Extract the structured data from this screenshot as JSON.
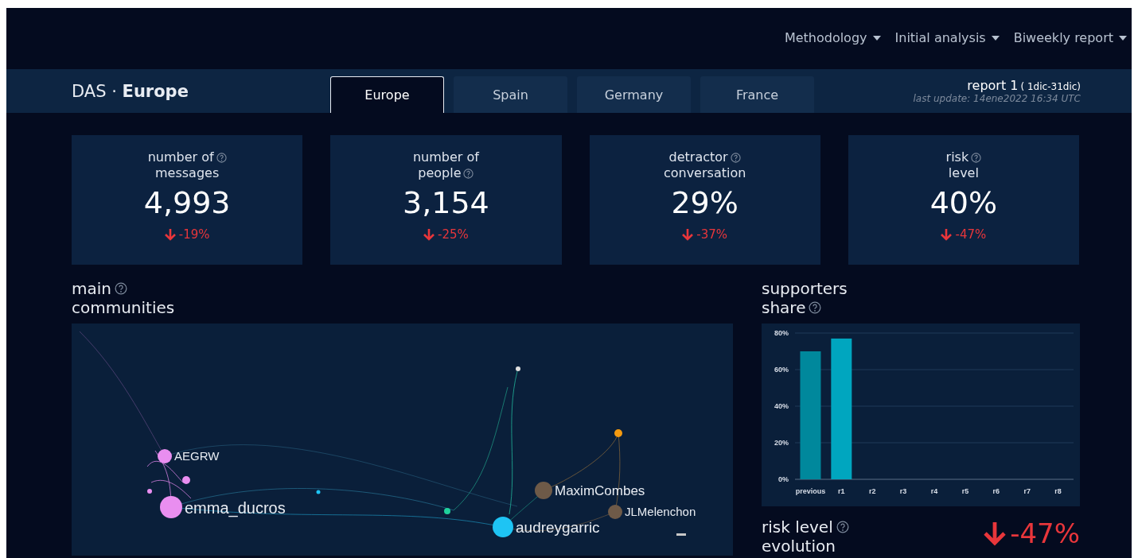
{
  "nav": {
    "items": [
      {
        "label": "Methodology"
      },
      {
        "label": "Initial analysis"
      },
      {
        "label": "Biweekly report"
      }
    ]
  },
  "header": {
    "title": "DAS · **Europe**",
    "report": "report 1",
    "period": "( 1dic-31dic)",
    "updated": "last update: 14ene2022 16:34 UTC"
  },
  "tabs": [
    {
      "label": "Europe",
      "selected": true
    },
    {
      "label": "Spain",
      "selected": false
    },
    {
      "label": "Germany",
      "selected": false
    },
    {
      "label": "France",
      "selected": false
    }
  ],
  "cards": [
    {
      "label_top": "number of",
      "label_bottom": "messages",
      "help_on_top": true,
      "value": "4,993",
      "trend": {
        "falling": true,
        "text": "-19%"
      }
    },
    {
      "label_top": "number of",
      "label_bottom": "people",
      "help_on_top": false,
      "value": "3,154",
      "trend": {
        "falling": true,
        "text": "-25%"
      }
    },
    {
      "label_top": "detractor",
      "label_bottom": "conversation",
      "help_on_top": true,
      "value": "29%",
      "trend": {
        "falling": true,
        "text": "-37%"
      }
    },
    {
      "label_top": "risk",
      "label_bottom": "level",
      "help_on_top": true,
      "value": "40%",
      "trend": {
        "falling": true,
        "text": "-47%"
      }
    }
  ],
  "communities": {
    "title_top": "main",
    "title_bottom": "communities",
    "nodes": [
      {
        "label": "AEGRW",
        "color": "#e98ef0"
      },
      {
        "label": "emma_ducros",
        "color": "#e98ef0"
      },
      {
        "label": "MaximCombes",
        "color": "#6e5a48"
      },
      {
        "label": "JLMelenchon",
        "color": "#6e5a48"
      },
      {
        "label": "audreygarric",
        "color": "#1ec4f4"
      }
    ]
  },
  "supporters": {
    "title_top": "supporters",
    "title_bottom": "share",
    "chart_data": {
      "type": "bar",
      "categories": [
        "previous",
        "r1",
        "r2",
        "r3",
        "r4",
        "r5",
        "r6",
        "r7",
        "r8"
      ],
      "series": [
        {
          "color": "#00889c",
          "values": [
            70,
            null,
            null,
            null,
            null,
            null,
            null,
            null,
            null
          ]
        },
        {
          "color": "#00a6bf",
          "values": [
            null,
            77,
            null,
            null,
            null,
            null,
            null,
            null,
            null
          ]
        }
      ],
      "grid": true,
      "ylim": [
        0,
        80
      ],
      "yticks": [
        {
          "value": 0,
          "label": "0%"
        },
        {
          "value": 20,
          "label": "20%"
        },
        {
          "value": 40,
          "label": "40%"
        },
        {
          "value": 60,
          "label": "60%"
        },
        {
          "value": 80,
          "label": "80%"
        }
      ]
    }
  },
  "risk_evolution": {
    "title_top": "risk level",
    "title_bottom": "evolution",
    "trend": {
      "falling": true,
      "text": "-47%"
    }
  }
}
